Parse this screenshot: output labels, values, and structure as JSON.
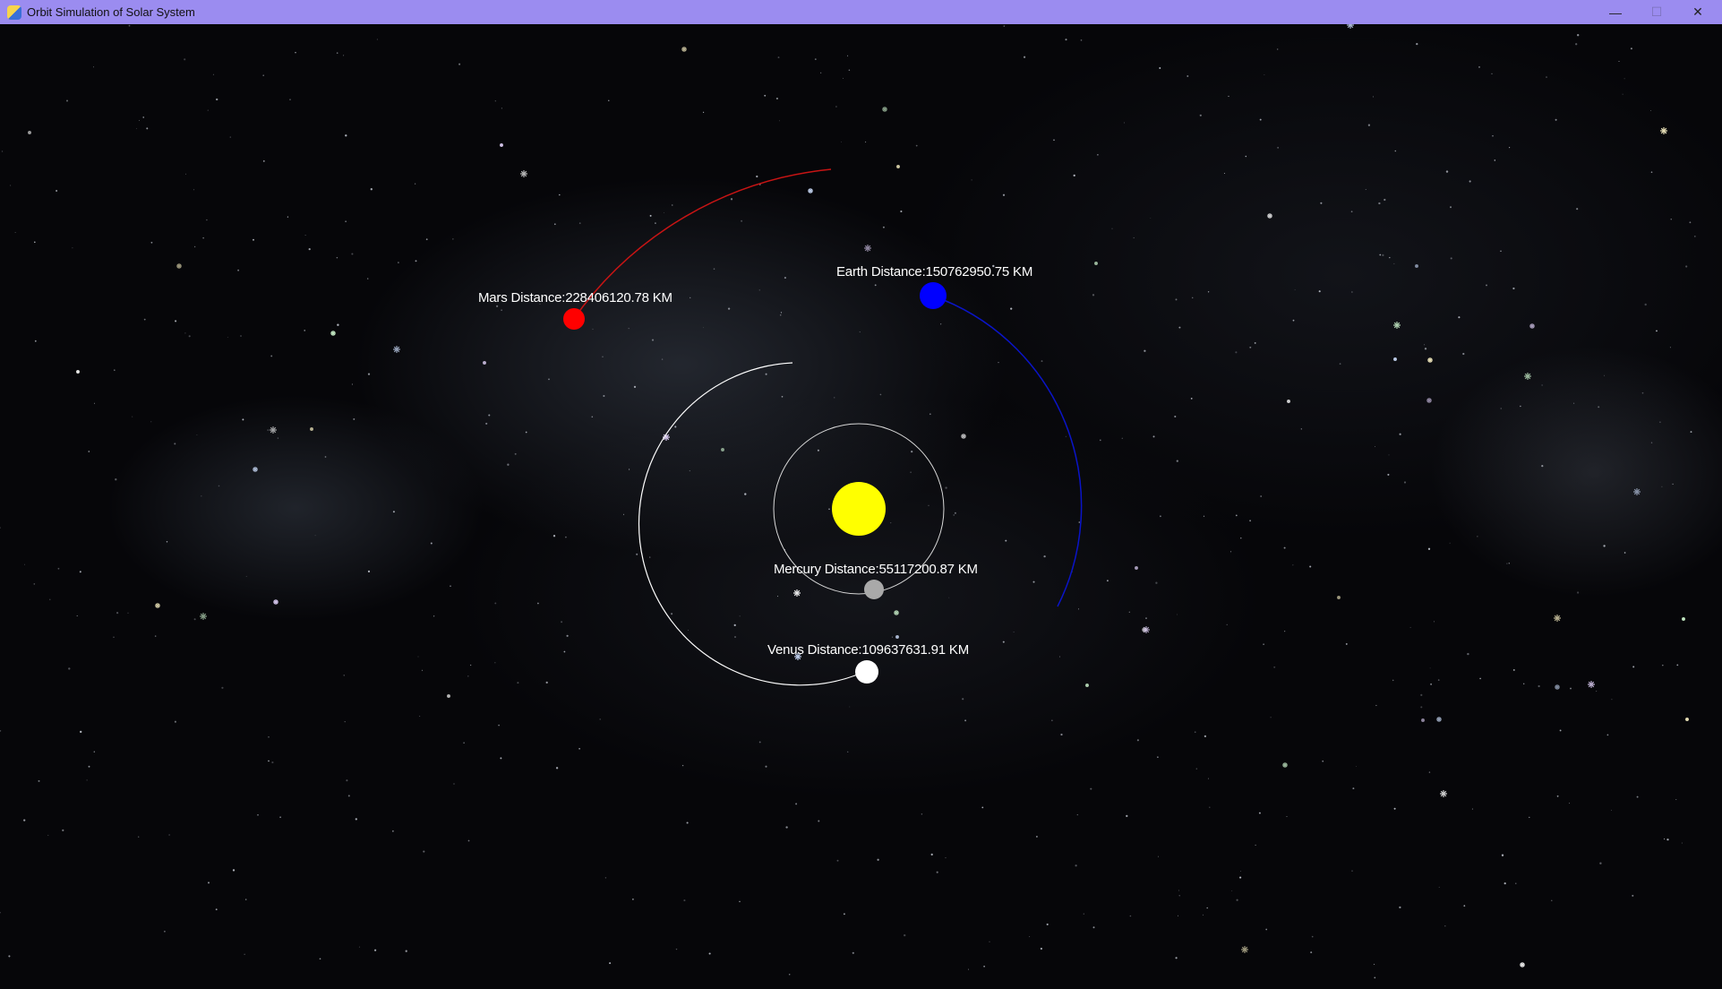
{
  "window": {
    "title": "Orbit Simulation of Solar System",
    "controls": {
      "minimize": "—",
      "maximize": "☐",
      "close": "✕"
    }
  },
  "colors": {
    "titlebar": "#9b8cf0",
    "sun": "#ffff00",
    "mercury": "#a9a9a9",
    "venus": "#ffffff",
    "earth": "#0000ff",
    "mars": "#ff0000",
    "mercury_orbit": "#d8d8d8",
    "venus_orbit": "#ffffff",
    "earth_orbit": "#0a14c8",
    "mars_orbit": "#c81414"
  },
  "bodies": {
    "sun": {
      "name": "Sun"
    },
    "mercury": {
      "label": "Mercury Distance:55117200.87 KM"
    },
    "venus": {
      "label": "Venus Distance:109637631.91 KM"
    },
    "earth": {
      "label": "Earth Distance:150762950.75 KM"
    },
    "mars": {
      "label": "Mars Distance:228406120.78 KM"
    }
  }
}
